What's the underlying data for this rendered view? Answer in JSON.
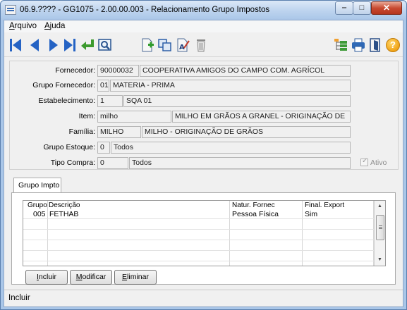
{
  "window": {
    "title": "06.9.???? - GG1075 - 2.00.00.003 - Relacionamento Grupo Impostos",
    "buttons": {
      "minimize": "‒",
      "maximize": "□",
      "close": "✕"
    }
  },
  "menu": {
    "items": [
      {
        "label_first": "A",
        "label_rest": "rquivo"
      },
      {
        "label_first": "A",
        "label_rest": "juda"
      }
    ]
  },
  "toolbar": {
    "icons": [
      "first-record-icon",
      "previous-record-icon",
      "next-record-icon",
      "last-record-icon",
      "go-to-icon",
      "search-icon",
      "new-icon",
      "copy-icon",
      "edit-icon",
      "delete-icon",
      "tree-icon",
      "print-icon",
      "exit-icon",
      "help-icon"
    ],
    "help_glyph": "?"
  },
  "form": {
    "fornecedor": {
      "label": "Fornecedor:",
      "code": "90000032",
      "name": "COOPERATIVA AMIGOS DO CAMPO COM. AGRÍCOL"
    },
    "grupo_fornecedor": {
      "label": "Grupo Fornecedor:",
      "code": "01",
      "name": "MATERIA - PRIMA"
    },
    "estabelecimento": {
      "label": "Estabelecimento:",
      "code": "1",
      "name": "SQA 01"
    },
    "item": {
      "label": "Item:",
      "code": "milho",
      "name": "MILHO EM GRÃOS A GRANEL - ORIGINAÇÃO DE"
    },
    "familia": {
      "label": "Família:",
      "code": "MILHO",
      "name": "MILHO - ORIGINAÇÃO DE GRÃOS"
    },
    "grupo_estoque": {
      "label": "Grupo Estoque:",
      "code": "0",
      "name": "Todos"
    },
    "tipo_compra": {
      "label": "Tipo Compra:",
      "code": "0",
      "name": "Todos"
    },
    "ativo": {
      "label": "Ativo",
      "checked": true
    }
  },
  "tab": {
    "label": "Grupo Impto"
  },
  "grid": {
    "headers": [
      "Grupo",
      "Descrição",
      "Natur. Fornec",
      "Final. Export"
    ],
    "rows": [
      [
        "005",
        "FETHAB",
        "Pessoa Física",
        "Sim"
      ]
    ],
    "scroll_up": "▲",
    "scroll_down": "▼"
  },
  "buttons": {
    "incluir": {
      "first": "I",
      "rest": "ncluir"
    },
    "modificar": {
      "first": "M",
      "rest": "odificar"
    },
    "eliminar": {
      "first": "E",
      "rest": "liminar"
    }
  },
  "status": {
    "text": "Incluir"
  }
}
